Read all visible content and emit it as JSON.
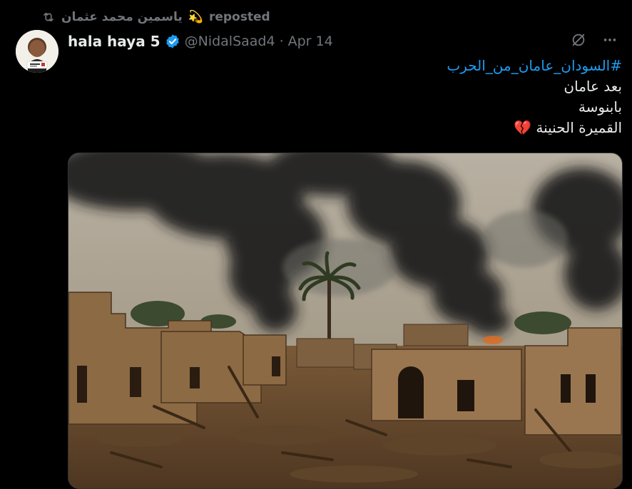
{
  "repost": {
    "icon": "repost-icon",
    "user": "ياسمين محمد عثمان",
    "emoji": "💫",
    "label": "reposted"
  },
  "tweet": {
    "author_name": "hala haya 5",
    "verified_icon": "verified-badge-icon",
    "handle": "@NidalSaad4",
    "separator": "·",
    "date": "Apr 14",
    "hashtag": "#السودان_عامان_من_الحرب",
    "lines": [
      "بعد عامان",
      "بابنوسة",
      "القميرة الحنينة 💔"
    ],
    "grok_icon": "grok-icon",
    "more_icon": "more-options-icon"
  },
  "colors": {
    "background": "#000000",
    "text": "#e7e9ea",
    "muted": "#71767b",
    "accent": "#1d9bf0"
  }
}
